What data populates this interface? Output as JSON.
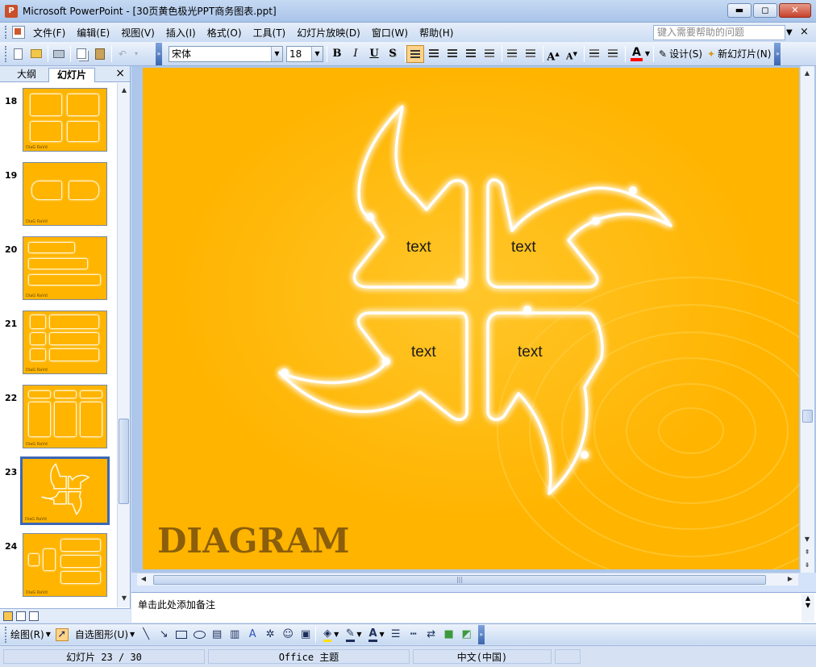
{
  "window": {
    "title": "Microsoft PowerPoint - [30页黄色极光PPT商务图表.ppt]",
    "buttons": {
      "minimize": "▬",
      "restore": "◻",
      "close": "✕"
    }
  },
  "menu": {
    "items": [
      "文件(F)",
      "编辑(E)",
      "视图(V)",
      "插入(I)",
      "格式(O)",
      "工具(T)",
      "幻灯片放映(D)",
      "窗口(W)",
      "帮助(H)"
    ],
    "help_placeholder": "键入需要帮助的问题",
    "close_doc": "×"
  },
  "toolbar": {
    "font": "宋体",
    "size": "18",
    "bold": "B",
    "italic": "I",
    "underline": "U",
    "shadow": "S",
    "grow": "A",
    "shrink": "A",
    "font_color": "A",
    "design_label": "设计(S)",
    "new_slide_label": "新幻灯片(N)"
  },
  "left_pane": {
    "tab_outline": "大纲",
    "tab_slides": "幻灯片",
    "close": "×",
    "thumbnails": [
      {
        "num": "18",
        "footer": "DiaG RaVd"
      },
      {
        "num": "19",
        "footer": "DiaG RaVd"
      },
      {
        "num": "20",
        "footer": "DiaG RaVd"
      },
      {
        "num": "21",
        "footer": "DiaG RaVd"
      },
      {
        "num": "22",
        "footer": "DiaG RaVd"
      },
      {
        "num": "23",
        "footer": "DiaG RaVd"
      },
      {
        "num": "24",
        "footer": "DiaG RaVd"
      }
    ],
    "selected": "23"
  },
  "slide": {
    "title": "DIAGRAM",
    "petals": [
      "text",
      "text",
      "text",
      "text"
    ],
    "colors": {
      "background": "#FFB400",
      "title": "#8B5E0C",
      "glow": "#FFFFFF"
    }
  },
  "notes": {
    "placeholder": "单击此处添加备注"
  },
  "drawing_toolbar": {
    "draw_label": "绘图(R)",
    "autoshape_label": "自选图形(U)"
  },
  "status": {
    "slide_position": "幻灯片 23 / 30",
    "theme": "Office 主题",
    "language": "中文(中国)"
  }
}
